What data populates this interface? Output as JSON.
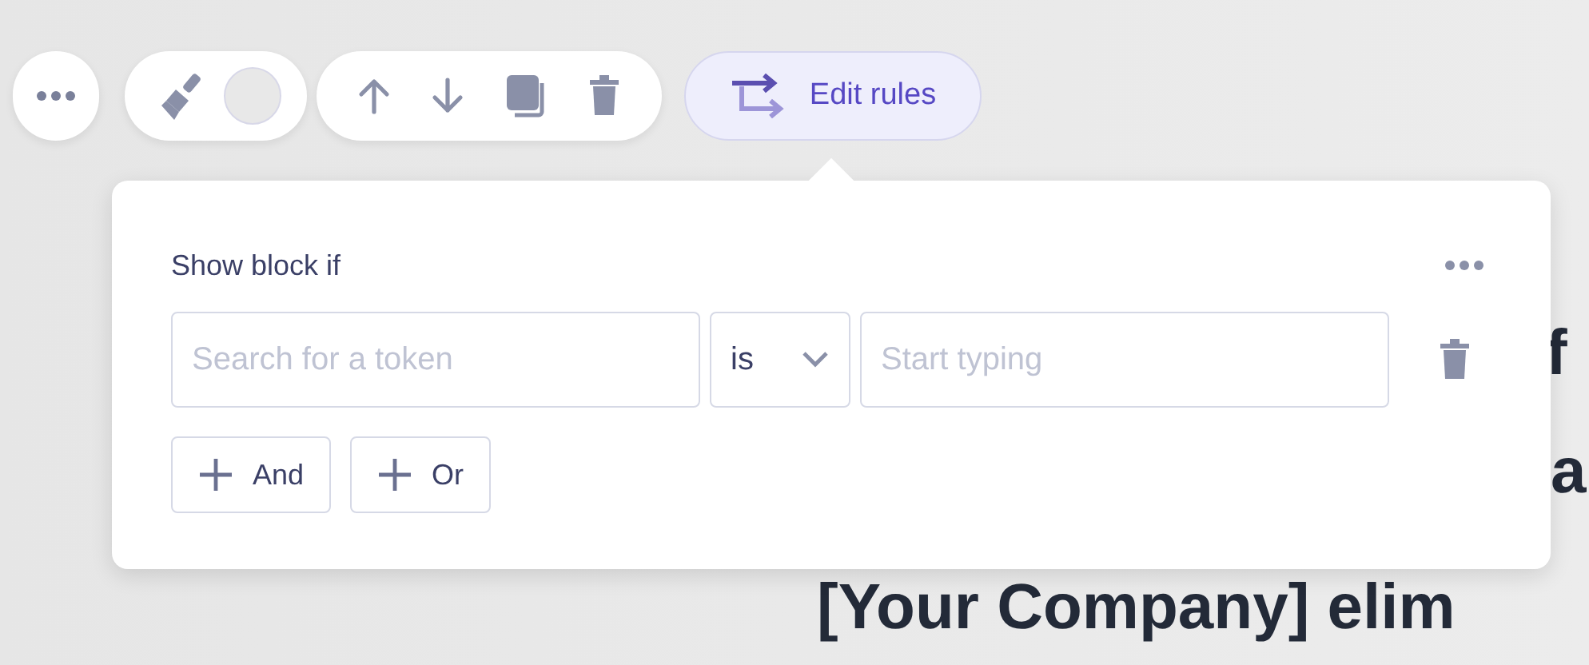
{
  "toolbar": {
    "edit_rules": {
      "label": "Edit rules",
      "selected": true
    }
  },
  "popover": {
    "title": "Show block if",
    "token_field": {
      "placeholder": "Search for a token"
    },
    "operator": {
      "value": "is"
    },
    "value_field": {
      "placeholder": "Start typing"
    },
    "buttons": [
      {
        "label": "And"
      },
      {
        "label": "Or"
      }
    ]
  },
  "background_text": [
    "f",
    "a",
    "[Your Company] elim"
  ]
}
